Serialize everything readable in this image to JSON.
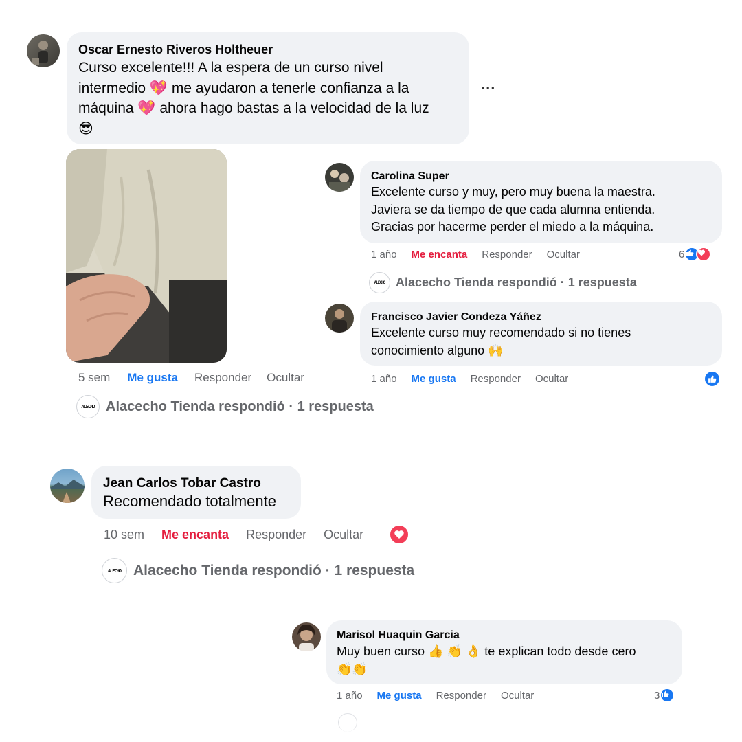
{
  "store_name": "Alacecho Tienda",
  "store_logo_text": "ALECHO",
  "colors": {
    "bubble": "#f0f2f5",
    "like_blue": "#1877f2",
    "love_red": "#e41e3f",
    "meta_gray": "#65676b"
  },
  "comments": [
    {
      "author": "Oscar Ernesto Riveros Holtheuer",
      "lines": [
        "Curso excelente!!! A la espera de un curso nivel",
        "intermedio 💖 me ayudaron a tenerle confianza a la",
        "máquina 💖 ahora hago bastas a la velocidad de la luz",
        "😎"
      ],
      "more_label": "...",
      "time": "5 sem",
      "reaction_label": "Me gusta",
      "reply_label": "Responder",
      "hide_label": "Ocultar",
      "replied_text": "Alacecho Tienda respondió · 1 respuesta"
    },
    {
      "author": "Carolina Super",
      "lines": [
        "Excelente curso y muy, pero muy buena la maestra.",
        "Javiera se da tiempo de que cada alumna entienda.",
        "Gracias por hacerme perder el miedo a la máquina."
      ],
      "time": "1 año",
      "reaction_label": "Me encanta",
      "reply_label": "Responder",
      "hide_label": "Ocultar",
      "reaction_count": "6",
      "replied_text": "Alacecho Tienda respondió · 1 respuesta"
    },
    {
      "author": "Francisco Javier Condeza Yáñez",
      "lines": [
        "Excelente curso muy recomendado si no tienes",
        "conocimiento alguno 🙌"
      ],
      "time": "1 año",
      "reaction_label": "Me gusta",
      "reply_label": "Responder",
      "hide_label": "Ocultar"
    },
    {
      "author": "Jean Carlos Tobar Castro",
      "lines": [
        "Recomendado totalmente"
      ],
      "time": "10 sem",
      "reaction_label": "Me encanta",
      "reply_label": "Responder",
      "hide_label": "Ocultar",
      "replied_text": "Alacecho Tienda respondió · 1 respuesta"
    },
    {
      "author": "Marisol Huaquin Garcia",
      "lines": [
        "Muy buen curso 👍 👏 👌 te explican todo desde cero",
        "👏👏"
      ],
      "time": "1 año",
      "reaction_label": "Me gusta",
      "reply_label": "Responder",
      "hide_label": "Ocultar",
      "reaction_count": "3"
    }
  ]
}
